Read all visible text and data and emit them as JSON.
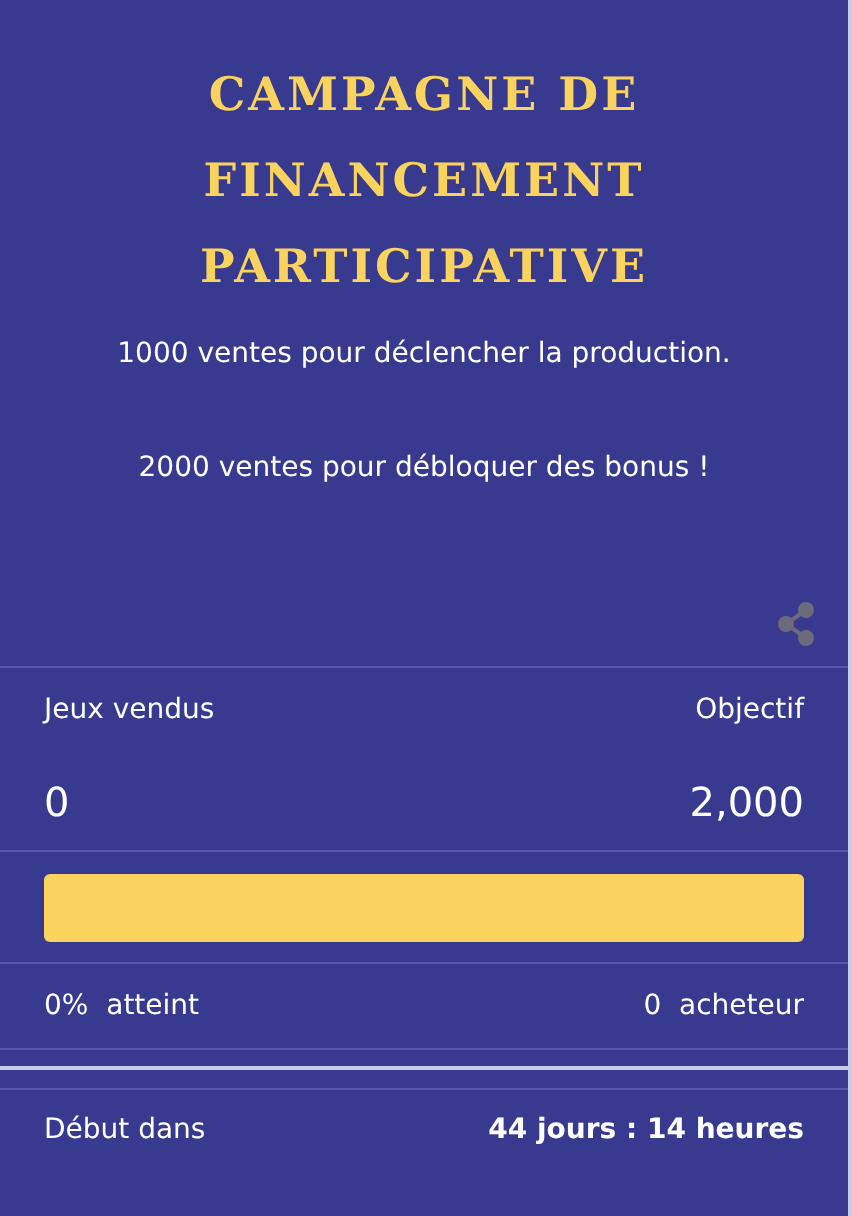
{
  "title": "CAMPAGNE DE FINANCEMENT PARTICIPATIVE",
  "descriptions": [
    "1000 ventes pour déclencher la production.",
    "2000 ventes pour débloquer des bonus !"
  ],
  "stats": {
    "sold_label": "Jeux vendus",
    "goal_label": "Objectif",
    "sold_value": "0",
    "goal_value": "2,000"
  },
  "progress": {
    "level": 0
  },
  "summary": {
    "percent": "0%",
    "percent_label": "atteint",
    "buyers": "0",
    "buyers_label": "acheteur"
  },
  "countdown": {
    "label": "Début dans",
    "value": "44 jours : 14 heures"
  }
}
